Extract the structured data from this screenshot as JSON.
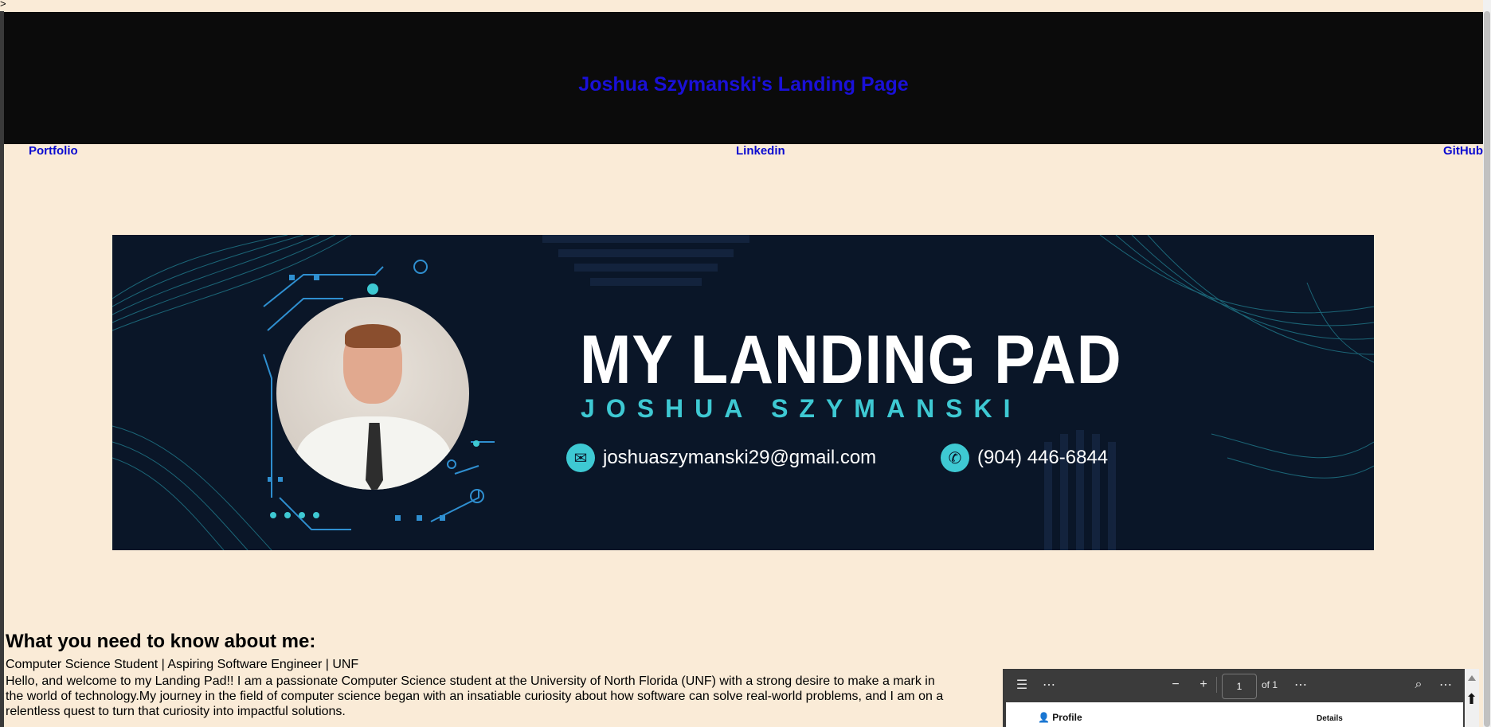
{
  "page": {
    "stray_text": ">",
    "title": "Joshua Szymanski's Landing Page"
  },
  "nav": {
    "portfolio": "Portfolio",
    "linkedin": "Linkedin",
    "github": "GitHub"
  },
  "banner": {
    "title": "MY LANDING PAD",
    "subtitle": "JOSHUA SZYMANSKI",
    "email": "joshuaszymanski29@gmail.com",
    "phone": "(904) 446-6844",
    "email_icon": "mail-icon",
    "phone_icon": "phone-icon",
    "accent": "#3ec9d3",
    "background": "#0a1628"
  },
  "about": {
    "heading": "What you need to know about me:",
    "tagline": "Computer Science Student | Aspiring Software Engineer | UNF",
    "bio": "Hello, and welcome to my Landing Pad!! I am a passionate Computer Science student at the University of North Florida (UNF) with a strong desire to make a mark in the world of technology.My journey in the field of computer science began with an insatiable curiosity about how software can solve real-world problems, and I am on a relentless quest to turn that curiosity into impactful solutions."
  },
  "pdf_viewer": {
    "page_value": "1",
    "of_label": "of 1",
    "doc_profile": "Profile",
    "doc_details": "Details",
    "icons": {
      "contents": "list-icon",
      "more": "more-icon",
      "zoom_out": "minus-icon",
      "zoom_in": "plus-icon",
      "search": "search-icon"
    }
  },
  "colors": {
    "page_bg": "#FAEBD7",
    "header_bg": "#0b0b0b",
    "link": "#0a0ad0",
    "header_title": "#1a10d8"
  }
}
